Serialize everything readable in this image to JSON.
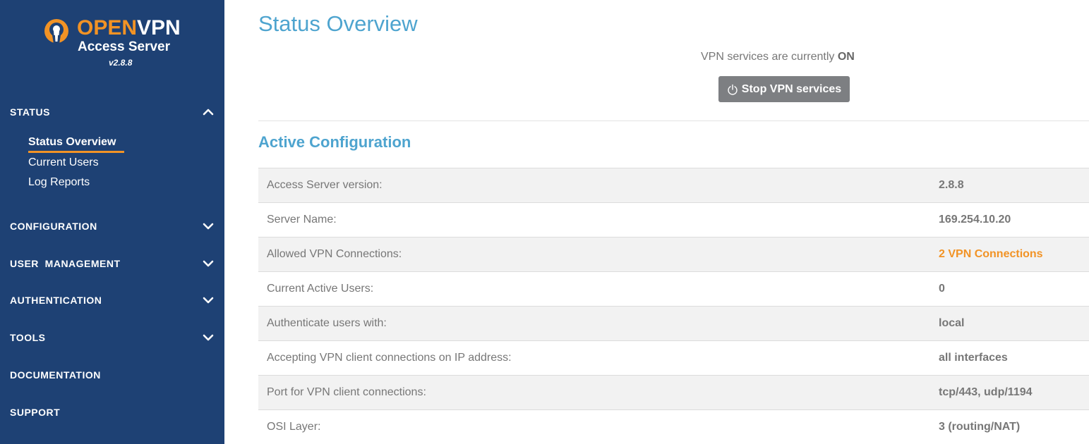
{
  "brand": {
    "open": "OPEN",
    "vpn": "VPN",
    "product": "Access Server",
    "version": "v2.8.8",
    "accent": "#f29325",
    "sidebar_bg": "#1e4174"
  },
  "sidebar": {
    "status_label": "STATUS",
    "status_items": [
      {
        "label": "Status Overview",
        "active": true
      },
      {
        "label": "Current Users",
        "active": false
      },
      {
        "label": "Log Reports",
        "active": false
      }
    ],
    "sections": [
      {
        "label": "CONFIGURATION",
        "icon": "chevron-down-icon"
      },
      {
        "label": "USER  MANAGEMENT",
        "icon": "chevron-down-icon"
      },
      {
        "label": "AUTHENTICATION",
        "icon": "chevron-down-icon"
      },
      {
        "label": "TOOLS",
        "icon": "chevron-down-icon"
      },
      {
        "label": "DOCUMENTATION"
      },
      {
        "label": "SUPPORT"
      }
    ]
  },
  "main": {
    "title": "Status Overview",
    "status_prefix": "VPN services are currently ",
    "status_value": "ON",
    "stop_button": "Stop VPN services",
    "section_title": "Active Configuration",
    "rows": [
      {
        "label": "Access Server version:",
        "value": "2.8.8"
      },
      {
        "label": "Server Name:",
        "value": "169.254.10.20"
      },
      {
        "label": "Allowed VPN Connections:",
        "value": "2 VPN Connections",
        "link": true
      },
      {
        "label": "Current Active Users:",
        "value": "0"
      },
      {
        "label": "Authenticate users with:",
        "value": "local"
      },
      {
        "label": "Accepting VPN client connections on IP address:",
        "value": "all interfaces"
      },
      {
        "label": "Port for VPN client connections:",
        "value": "tcp/443, udp/1194"
      },
      {
        "label": "OSI Layer:",
        "value": "3 (routing/NAT)"
      }
    ]
  }
}
